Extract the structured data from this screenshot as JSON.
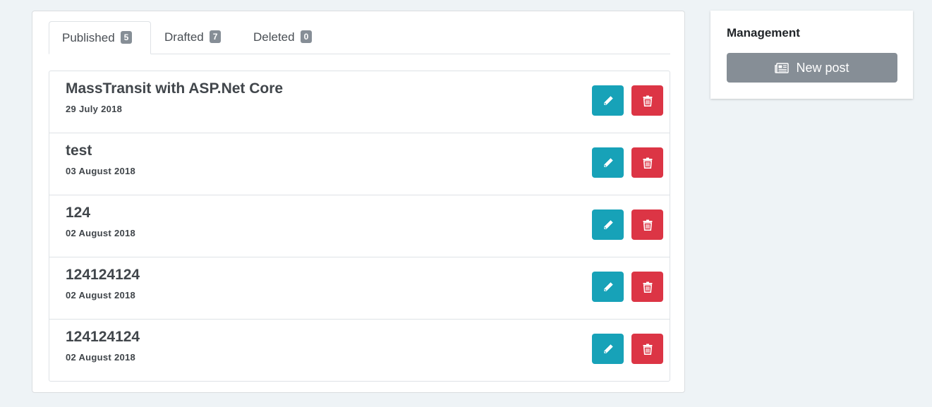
{
  "tabs": [
    {
      "label": "Published",
      "count": "5",
      "active": true
    },
    {
      "label": "Drafted",
      "count": "7",
      "active": false
    },
    {
      "label": "Deleted",
      "count": "0",
      "active": false
    }
  ],
  "posts": [
    {
      "title": "MassTransit with ASP.Net Core",
      "date": "29 July 2018"
    },
    {
      "title": "test",
      "date": "03 August 2018"
    },
    {
      "title": "124",
      "date": "02 August 2018"
    },
    {
      "title": "124124124",
      "date": "02 August 2018"
    },
    {
      "title": "124124124",
      "date": "02 August 2018"
    }
  ],
  "icons": {
    "edit": "pencil-icon",
    "delete": "trash-icon",
    "new_post": "newspaper-icon"
  },
  "sidebar": {
    "title": "Management",
    "new_post_label": "New post"
  },
  "colors": {
    "edit_button": "#17a2b8",
    "delete_button": "#dc3545",
    "badge": "#868e96",
    "new_post_button": "#868e96",
    "page_background": "#eef3f6"
  }
}
